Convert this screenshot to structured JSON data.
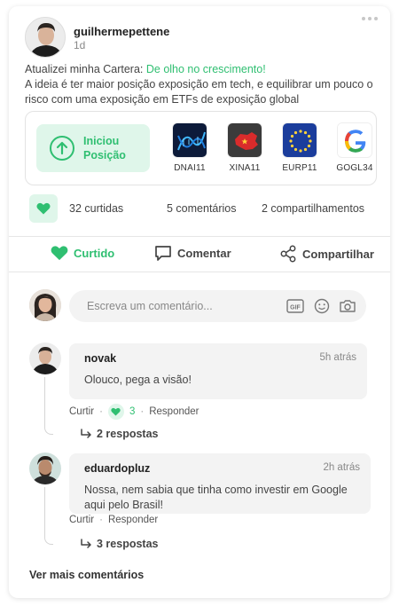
{
  "post": {
    "username": "guilhermepettene",
    "time": "1d",
    "text_prefix": "Atualizei minha Cartera: ",
    "text_link": "De olho no crescimento!",
    "text_body": "A ideia é ter maior posição exposição em tech, e equilibrar um pouco o risco com uma exposição em ETFs de exposição global"
  },
  "wallet": {
    "position_label_1": "Iniciou",
    "position_label_2": "Posição",
    "assets": [
      {
        "ticker": "DNAI11",
        "icon": "dna-helix-logo"
      },
      {
        "ticker": "XINA11",
        "icon": "china-map-logo"
      },
      {
        "ticker": "EURP11",
        "icon": "eu-flag-logo"
      },
      {
        "ticker": "GOGL34",
        "icon": "google-g-logo"
      }
    ]
  },
  "stats": {
    "likes": "32 curtidas",
    "comments": "5 comentários",
    "shares": "2 compartilhamentos"
  },
  "actions": {
    "like": "Curtido",
    "comment": "Comentar",
    "share": "Compartilhar"
  },
  "comment_input": {
    "placeholder": "Escreva um comentário..."
  },
  "comments": [
    {
      "author": "novak",
      "time": "5h atrás",
      "text": "Olouco, pega a visão!",
      "like_label": "Curtir",
      "like_count": "3",
      "reply_label": "Responder",
      "replies": "2 respostas"
    },
    {
      "author": "eduardopluz",
      "time": "2h atrás",
      "text": "Nossa, nem sabia que tinha como investir em Google aqui pelo Brasil!",
      "like_label": "Curtir",
      "reply_label": "Responder",
      "replies": "3 respostas"
    }
  ],
  "see_more": "Ver mais comentários",
  "colors": {
    "accent": "#2fbf71",
    "accent_light": "#dff6ea",
    "bubble": "#f3f3f3"
  }
}
